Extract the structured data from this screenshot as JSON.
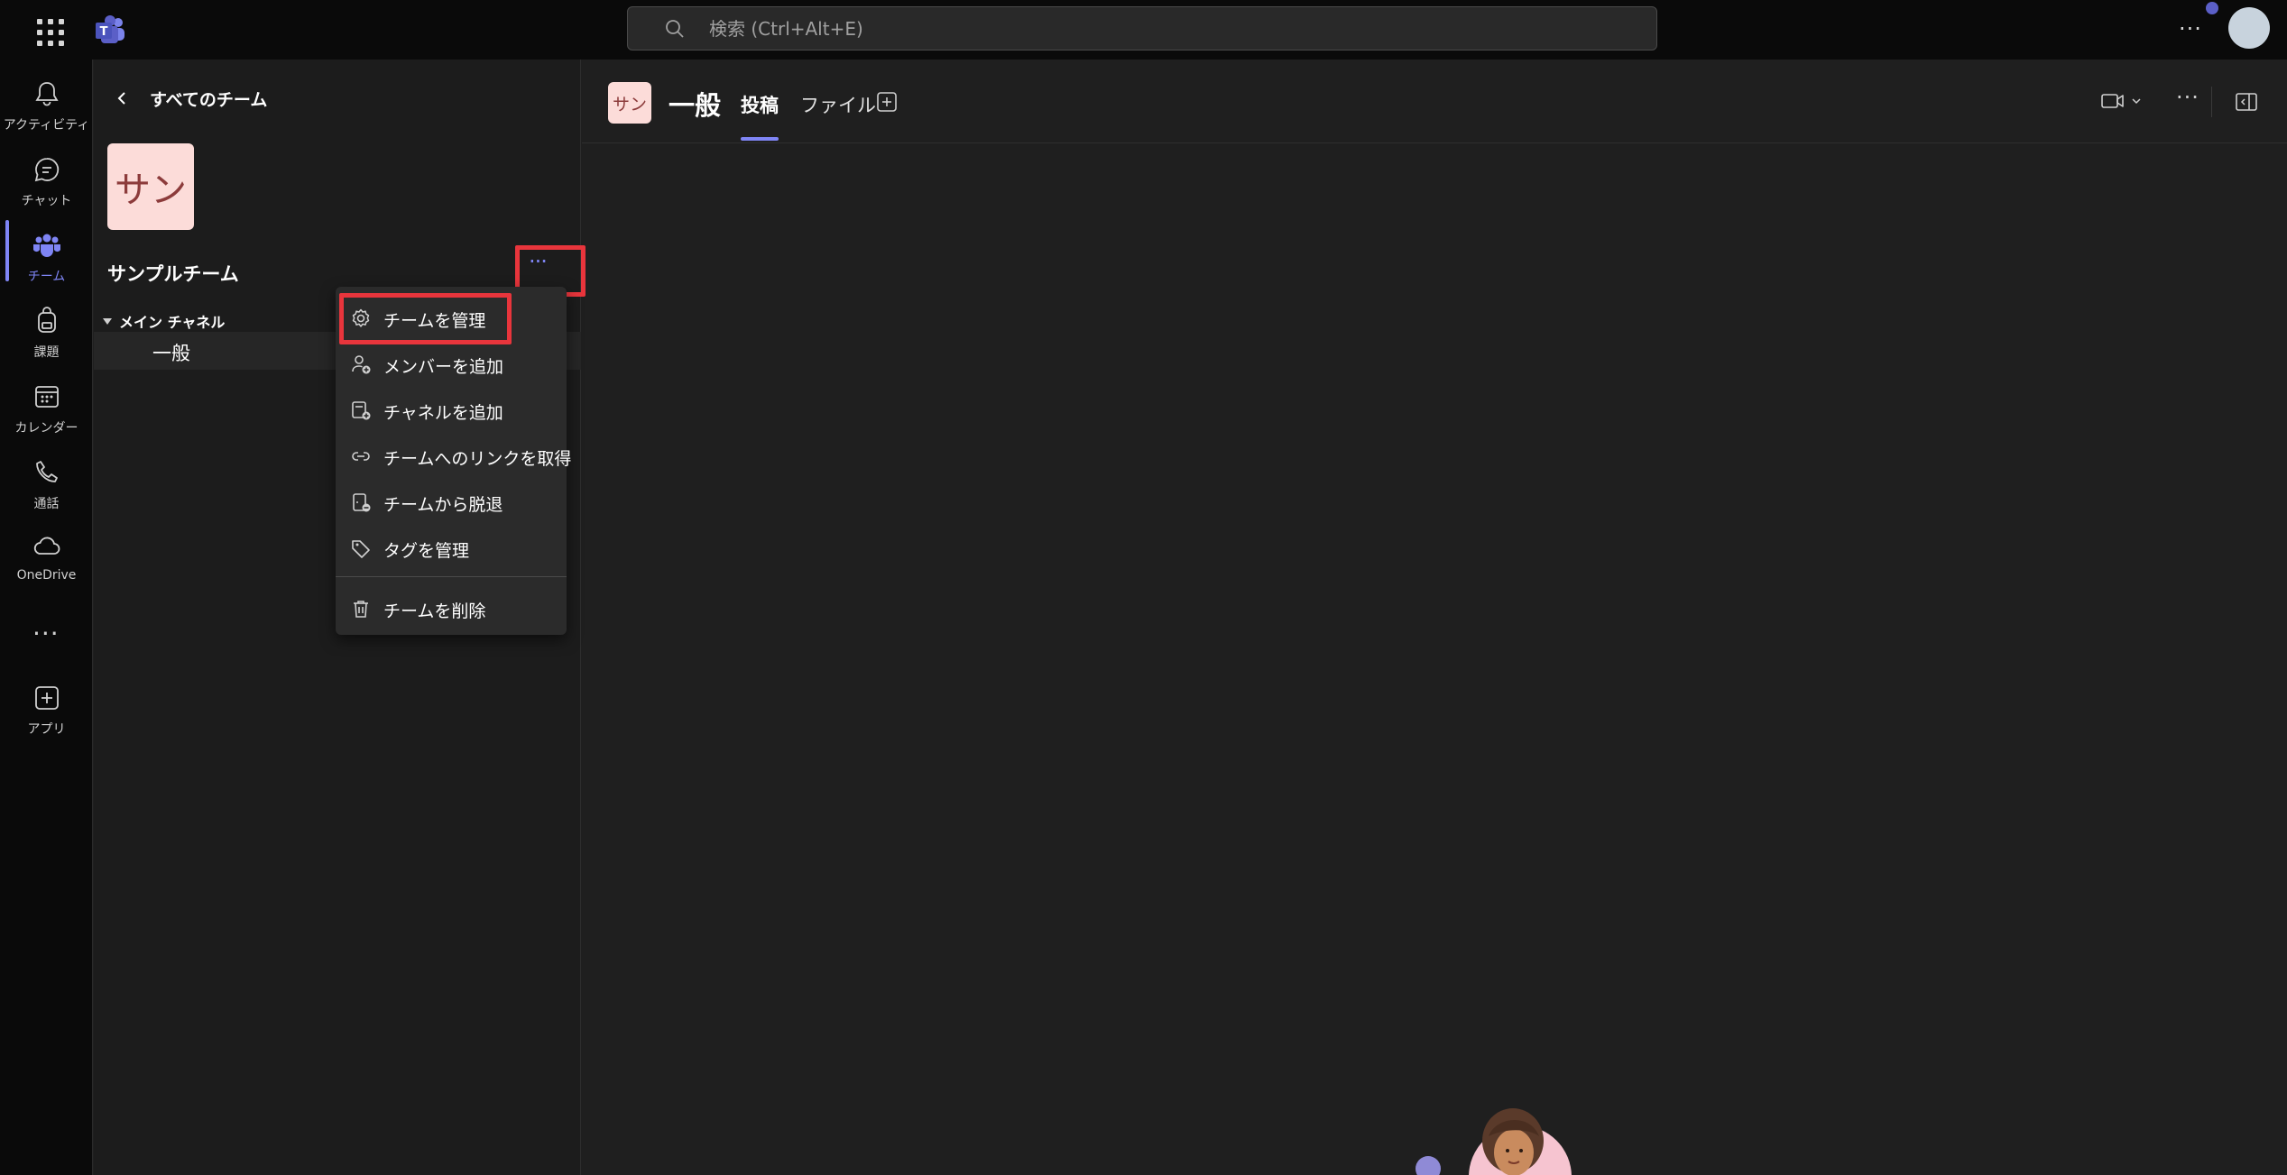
{
  "search": {
    "placeholder": "検索 (Ctrl+Alt+E)"
  },
  "rail": {
    "items": [
      {
        "label": "アクティビティ",
        "icon": "bell-icon"
      },
      {
        "label": "チャット",
        "icon": "chat-icon"
      },
      {
        "label": "チーム",
        "icon": "teams-icon",
        "active": true
      },
      {
        "label": "課題",
        "icon": "backpack-icon"
      },
      {
        "label": "カレンダー",
        "icon": "calendar-icon"
      },
      {
        "label": "通話",
        "icon": "phone-icon"
      },
      {
        "label": "OneDrive",
        "icon": "cloud-icon"
      },
      {
        "label": "アプリ",
        "icon": "add-app-icon"
      }
    ]
  },
  "team_panel": {
    "back_label": "すべてのチーム",
    "team_avatar_text": "サン",
    "team_name": "サンプルチーム",
    "section_label": "メイン チャネル",
    "channels": [
      {
        "label": "一般"
      }
    ]
  },
  "context_menu": {
    "items": [
      {
        "label": "チームを管理",
        "icon": "gear-icon"
      },
      {
        "label": "メンバーを追加",
        "icon": "add-person-icon"
      },
      {
        "label": "チャネルを追加",
        "icon": "add-channel-icon"
      },
      {
        "label": "チームへのリンクを取得",
        "icon": "link-icon"
      },
      {
        "label": "チームから脱退",
        "icon": "leave-icon"
      },
      {
        "label": "タグを管理",
        "icon": "tag-icon"
      },
      {
        "label": "チームを削除",
        "icon": "trash-icon"
      }
    ]
  },
  "channel_header": {
    "avatar_text": "サン",
    "title": "一般",
    "tabs": [
      {
        "label": "投稿",
        "active": true
      },
      {
        "label": "ファイル"
      }
    ]
  },
  "colors": {
    "accent": "#7f85f5",
    "highlight": "#e8353c",
    "avatar_bg": "#fcdcd9"
  }
}
